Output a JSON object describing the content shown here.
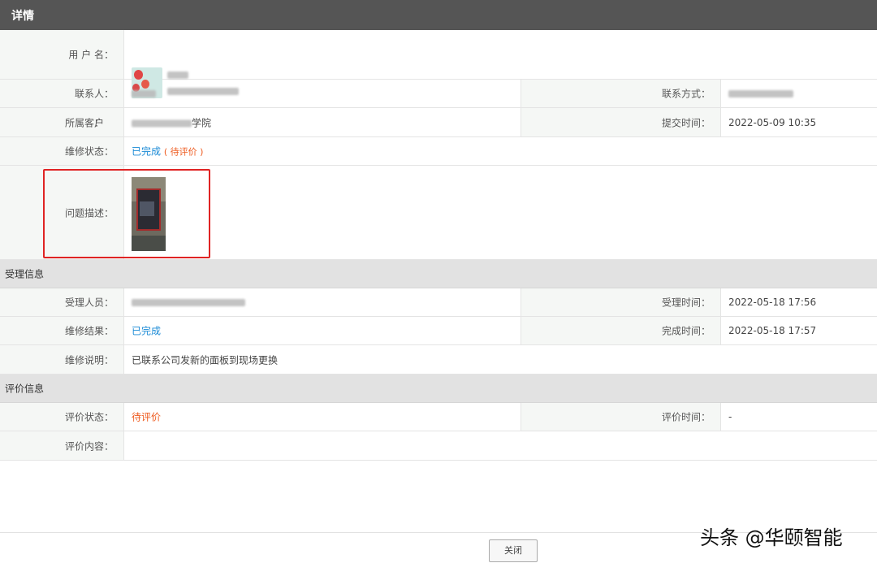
{
  "header": {
    "title": "详情"
  },
  "details": {
    "username_label": "用 户 名：",
    "contact_label": "联系人：",
    "contact_method_label": "联系方式：",
    "customer_label": "所属客户",
    "customer_label_colon": "：",
    "customer_value_visible": "学院",
    "submit_time_label": "提交时间：",
    "submit_time_value": "2022-05-09 10:35",
    "repair_status_label": "维修状态：",
    "repair_status_value": "已完成",
    "repair_status_sub": "( 待评价 )",
    "problem_desc_label": "问题描述："
  },
  "acceptance": {
    "section_title": "受理信息",
    "handler_label": "受理人员：",
    "accept_time_label": "受理时间：",
    "accept_time_value": "2022-05-18 17:56",
    "result_label": "维修结果：",
    "result_value": "已完成",
    "finish_time_label": "完成时间：",
    "finish_time_value": "2022-05-18 17:57",
    "note_label": "维修说明：",
    "note_value": "已联系公司发新的面板到现场更换"
  },
  "evaluation": {
    "section_title": "评价信息",
    "status_label": "评价状态：",
    "status_value": "待评价",
    "time_label": "评价时间：",
    "time_value": "-",
    "content_label": "评价内容："
  },
  "footer": {
    "close_label": "关闭"
  },
  "watermark": "头条 @华颐智能",
  "colors": {
    "header_bg": "#555555",
    "link_blue": "#1a8ad6",
    "pending_orange": "#ee5a1e",
    "highlight_red": "#e02424"
  }
}
